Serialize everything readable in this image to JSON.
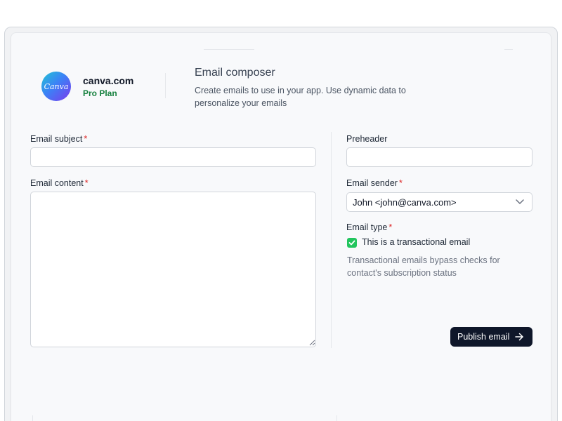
{
  "org": {
    "logo_text": "Canva",
    "name": "canva.com",
    "plan": "Pro Plan"
  },
  "header": {
    "title": "Email composer",
    "description": "Create emails to use in your app. Use dynamic data to personalize your emails"
  },
  "form": {
    "required_marker": "*",
    "email_subject": {
      "label": "Email subject",
      "value": "",
      "required": true
    },
    "email_content": {
      "label": "Email content",
      "value": "",
      "required": true
    },
    "preheader": {
      "label": "Preheader",
      "value": "",
      "required": false
    },
    "email_sender": {
      "label": "Email sender",
      "selected": "John <john@canva.com>",
      "required": true
    },
    "email_type": {
      "label": "Email type",
      "required": true,
      "checkbox_label": "This is a transactional email",
      "checked": true,
      "help_text": "Transactional emails bypass checks for contact's subscription status"
    },
    "publish_label": "Publish email"
  },
  "colors": {
    "accent_dark": "#0f172a",
    "success_green": "#22c55e",
    "plan_green": "#15803d",
    "required_red": "#dc2626"
  },
  "icons": {
    "dropdown": "chevron-down-icon",
    "publish": "arrow-right-icon",
    "checkbox": "check-icon"
  }
}
